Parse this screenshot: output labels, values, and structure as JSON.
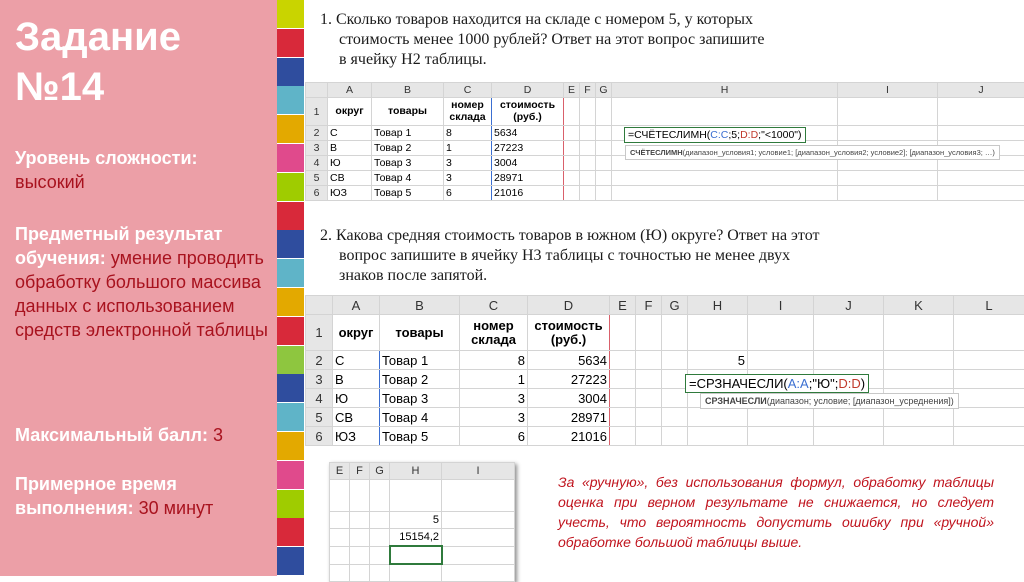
{
  "sidebar": {
    "title_line1": "Задание",
    "title_line2": "№14",
    "difficulty_label": "Уровень сложности:",
    "difficulty_value": "высокий",
    "result_label": "Предметный результат обучения:",
    "result_value": "умение проводить обработку большого массива данных с использованием средств электронной таблицы",
    "max_score_label": "Максимальный балл:",
    "max_score_value": "3",
    "time_label_1": "Примерное время",
    "time_label_2": "выполнения:",
    "time_value": "30 минут"
  },
  "strip_colors": [
    "#c9d400",
    "#d8293a",
    "#2f4d9e",
    "#5fb4c8",
    "#e3a900",
    "#e04a8c",
    "#9fcc00",
    "#d8293a",
    "#2f4d9e",
    "#5fb4c8",
    "#e3a900",
    "#d8293a",
    "#8ec63f",
    "#2f4d9e",
    "#5fb4c8",
    "#e3a900",
    "#e04a8c",
    "#9fcc00",
    "#d8293a",
    "#2f4d9e"
  ],
  "task1": {
    "lines": [
      "1. Сколько товаров находится на складе с номером 5, у которых",
      "стоимость менее 1000 рублей? Ответ на этот вопрос запишите",
      "в ячейку H2 таблицы."
    ]
  },
  "task2": {
    "lines": [
      "2. Какова средняя стоимость товаров в южном (Ю) округе? Ответ на этот",
      "вопрос запишите в ячейку H3 таблицы с точностью не менее двух",
      "знаков после запятой."
    ]
  },
  "sheet": {
    "cols": [
      "A",
      "B",
      "C",
      "D",
      "E",
      "F",
      "G",
      "H",
      "I",
      "J",
      "K",
      "L"
    ],
    "header": [
      "округ",
      "товары",
      "номер склада",
      "стоимость (руб.)"
    ],
    "rows": [
      {
        "n": "2",
        "a": "С",
        "b": "Товар 1",
        "c": "8",
        "d": "5634"
      },
      {
        "n": "3",
        "a": "В",
        "b": "Товар 2",
        "c": "1",
        "d": "27223"
      },
      {
        "n": "4",
        "a": "Ю",
        "b": "Товар 3",
        "c": "3",
        "d": "3004"
      },
      {
        "n": "5",
        "a": "СВ",
        "b": "Товар 4",
        "c": "3",
        "d": "28971"
      },
      {
        "n": "6",
        "a": "ЮЗ",
        "b": "Товар 5",
        "c": "6",
        "d": "21016"
      }
    ],
    "row1": "1"
  },
  "formula1": {
    "p1": "=СЧЁТЕСЛИМН(",
    "r1": "C:C",
    "p2": ";5;",
    "r2": "D:D",
    "p3": ";\"<1000\")",
    "tip_fn": "СЧЁТЕСЛИМН",
    "tip_args": "(диапазон_условия1; условие1; [диапазон_условия2; условие2]; [диапазон_условия3; …)"
  },
  "formula2": {
    "h2_value": "5",
    "p1": "=СРЗНАЧЕСЛИ(",
    "r1": "A:A",
    "p2": ";\"Ю\";",
    "r2": "D:D",
    "p3": ")",
    "tip_fn": "СРЗНАЧЕСЛИ",
    "tip_args": "(диапазон; условие; [диапазон_усреднения])"
  },
  "result_sheet": {
    "cols": [
      "E",
      "F",
      "G",
      "H",
      "I"
    ],
    "h2": "5",
    "h3": "15154,2"
  },
  "note": "За «ручную», без использования формул, обработку таблицы оценка при верном результате не снижается, но следует учесть, что вероятность допустить ошибку при «ручной» обработке большой таблицы выше."
}
